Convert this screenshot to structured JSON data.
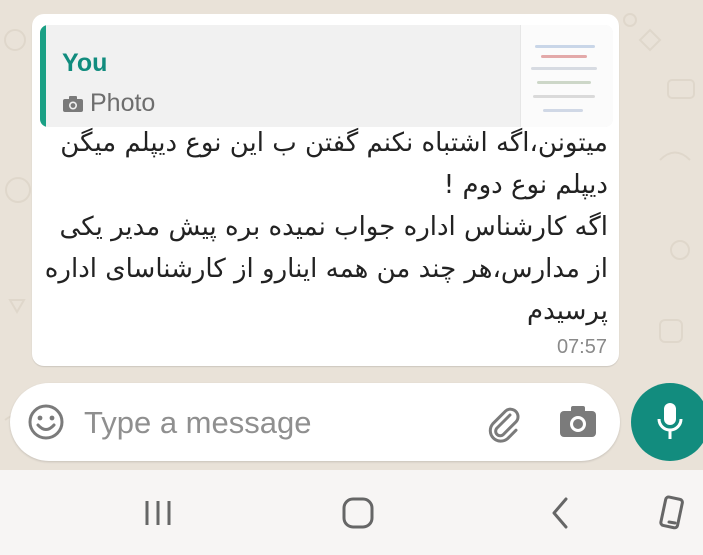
{
  "message": {
    "quote": {
      "author": "You",
      "type_label": "Photo",
      "author_color": "#118c7e",
      "bar_color": "#1aa085"
    },
    "lines": [
      "میتونن،اگه اشتباه نکنم گفتن ب این نوع دیپلم میگن",
      "دیپلم نوع دوم !",
      "اگه کارشناس اداره جواب نمیده بره پیش مدیر یکی",
      "از مدارس،هر چند من همه اینارو از کارشناسای اداره",
      "پرسیدم"
    ],
    "time": "07:57"
  },
  "composer": {
    "placeholder": "Type a message",
    "accent": "#128c7e"
  },
  "icons": {
    "emoji": "emoji-icon",
    "attach": "paperclip-icon",
    "camera": "camera-icon",
    "mic": "mic-icon",
    "nav_recents": "recents-icon",
    "nav_home": "home-icon",
    "nav_back": "back-icon",
    "nav_rotate": "rotate-icon"
  }
}
